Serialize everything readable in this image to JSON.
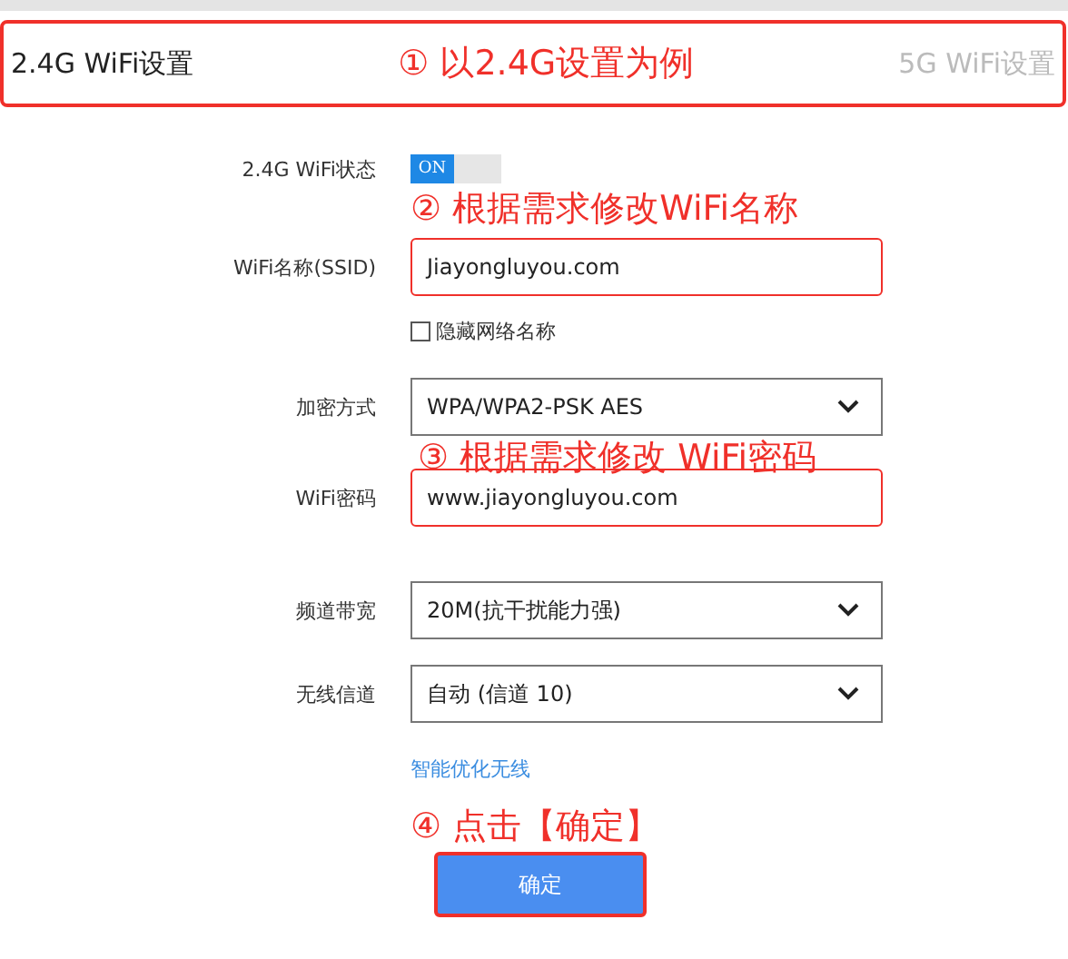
{
  "tab_bar": {
    "highlighted": true
  },
  "tabs": [
    {
      "label": "2.4G WiFi设置",
      "selected": true
    },
    {
      "label": "5G WiFi设置",
      "selected": false
    }
  ],
  "annotations": [
    "① 以2.4G设置为例",
    "② 根据需求修改WiFi名称",
    "③ 根据需求修改 WiFi密码",
    "④ 点击【确定】"
  ],
  "form": {
    "status": {
      "label": "2.4G WiFi状态",
      "toggle": "ON",
      "on": true
    },
    "ssid": {
      "label": "WiFi名称(SSID)",
      "value": "Jiayongluyou.com",
      "highlighted": true
    },
    "hide": {
      "label": "隐藏网络名称",
      "checked": false
    },
    "encryption": {
      "label": "加密方式",
      "value": "WPA/WPA2-PSK AES"
    },
    "password": {
      "label": "WiFi密码",
      "value": "www.jiayongluyou.com",
      "highlighted": true
    },
    "bandwidth": {
      "label": "频道带宽",
      "value": "20M(抗干扰能力强)"
    },
    "channel": {
      "label": "无线信道",
      "value": "自动 (信道 10)"
    },
    "optimize_link": "智能优化无线",
    "confirm": {
      "label": "确定",
      "highlighted": true
    }
  }
}
